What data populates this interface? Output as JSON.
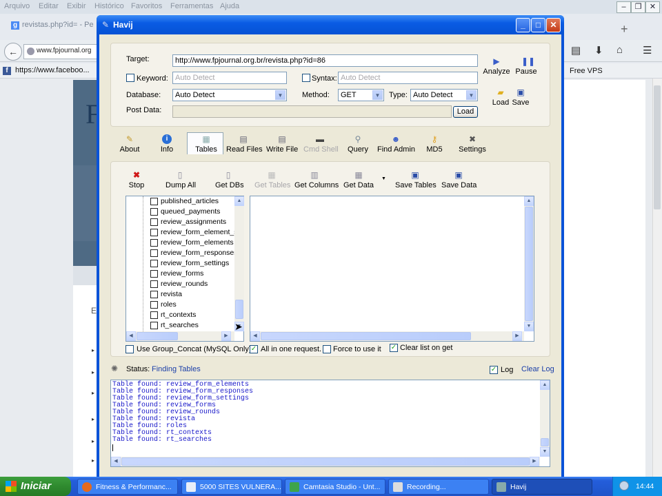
{
  "browser": {
    "menu": [
      "Arquivo",
      "Editar",
      "Exibir",
      "Histórico",
      "Favoritos",
      "Ferramentas",
      "Ajuda"
    ],
    "tab_title": "revistas.php?id= - Pe",
    "url": "www.fpjournal.org",
    "bookmark_1": "https://www.faceboo...",
    "bookmark_2": "Free VPS"
  },
  "app": {
    "title": "Havij",
    "target_label": "Target:",
    "target_value": "http://www.fpjournal.org.br/revista.php?id=86",
    "keyword_label": "Keyword:",
    "keyword_placeholder": "Auto Detect",
    "syntax_label": "Syntax:",
    "syntax_placeholder": "Auto Detect",
    "database_label": "Database:",
    "database_value": "Auto Detect",
    "method_label": "Method:",
    "method_value": "GET",
    "type_label": "Type:",
    "type_value": "Auto Detect",
    "postdata_label": "Post Data:",
    "load_button": "Load",
    "analyze": "Analyze",
    "pause": "Pause",
    "load": "Load",
    "save": "Save"
  },
  "tabs": [
    "About",
    "Info",
    "Tables",
    "Read Files",
    "Write File",
    "Cmd Shell",
    "Query",
    "Find Admin",
    "MD5",
    "Settings"
  ],
  "toolbar": [
    "Stop",
    "Dump All",
    "Get DBs",
    "Get Tables",
    "Get Columns",
    "Get Data",
    "Save Tables",
    "Save Data"
  ],
  "tree_items": [
    "published_articles",
    "queued_payments",
    "review_assignments",
    "review_form_element_s",
    "review_form_elements",
    "review_form_responses",
    "review_form_settings",
    "review_forms",
    "review_rounds",
    "revista",
    "roles",
    "rt_contexts",
    "rt_searches"
  ],
  "options": {
    "group_concat": "Use Group_Concat (MySQL Only)",
    "all_in_one": "All in one request.",
    "force": "Force to use it",
    "clear_list": "Clear list on get"
  },
  "status": {
    "label": "Status:",
    "value": "Finding Tables",
    "log_label": "Log",
    "clear_log": "Clear Log"
  },
  "log_lines": [
    "Table found: review_form_elements",
    "Table found: review_form_responses",
    "Table found: review_form_settings",
    "Table found: review_forms",
    "Table found: review_rounds",
    "Table found: revista",
    "Table found: roles",
    "Table found: rt_contexts",
    "Table found: rt_searches"
  ],
  "taskbar": {
    "start": "Iniciar",
    "items": [
      "Fitness & Performanc...",
      "5000 SITES VULNERA...",
      "Camtasia Studio - Unt...",
      "Recording...",
      "Havij"
    ],
    "clock": "14:44"
  }
}
